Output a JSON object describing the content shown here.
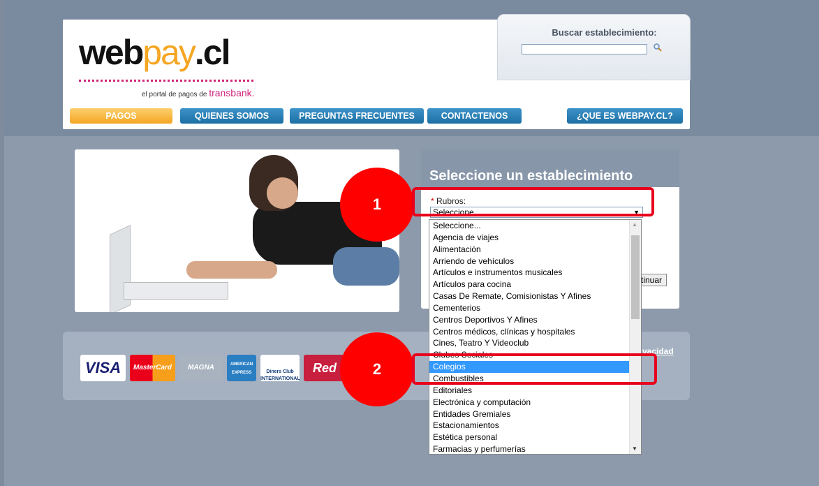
{
  "header": {
    "search_label": "Buscar establecimiento:",
    "logo": {
      "web": "web",
      "pay": "pay",
      "cl": ".cl"
    },
    "tagline": "el portal de pagos de ",
    "tagline_brand": "transbank.",
    "nav": [
      {
        "label": "PAGOS",
        "active": true
      },
      {
        "label": "QUIENES SOMOS"
      },
      {
        "label": "PREGUNTAS FRECUENTES"
      },
      {
        "label": "CONTACTENOS"
      },
      {
        "label": "¿QUE ES WEBPAY.CL?"
      }
    ]
  },
  "select_panel": {
    "title": "Seleccione un establecimiento",
    "rubros_label": "Rubros:",
    "required_mark": "*",
    "selected_value": "Seleccione",
    "continue_label": "tinuar"
  },
  "dropdown": {
    "items": [
      "Seleccione...",
      "Agencia de viajes",
      "Alimentación",
      "Arriendo de vehículos",
      "Artículos e instrumentos musicales",
      "Artículos para cocina",
      "Casas De Remate, Comisionistas Y Afines",
      "Cementerios",
      "Centros Deportivos Y Afines",
      "Centros médicos, clínicas y hospitales",
      "Cines, Teatro Y Videoclub",
      "Clubes Sociales",
      "Colegios",
      "Combustibles",
      "Editoriales",
      "Electrónica y computación",
      "Entidades Gremiales",
      "Estacionamientos",
      "Estética personal",
      "Farmacias y perfumerías"
    ],
    "highlighted": "Colegios"
  },
  "footer": {
    "privacy_link": "vacidad",
    "cards": [
      "VISA",
      "MasterCard",
      "MAGNA",
      "AMERICAN EXPRESS",
      "Diners Club INTERNATIONAL",
      "Red"
    ]
  },
  "callouts": [
    "1",
    "2"
  ],
  "colors": {
    "accent_orange": "#f5a623",
    "nav_blue": "#1d6fa3",
    "brand_pink": "#d0227a",
    "callout_red": "#ff0000",
    "selection_blue": "#3399ff"
  }
}
